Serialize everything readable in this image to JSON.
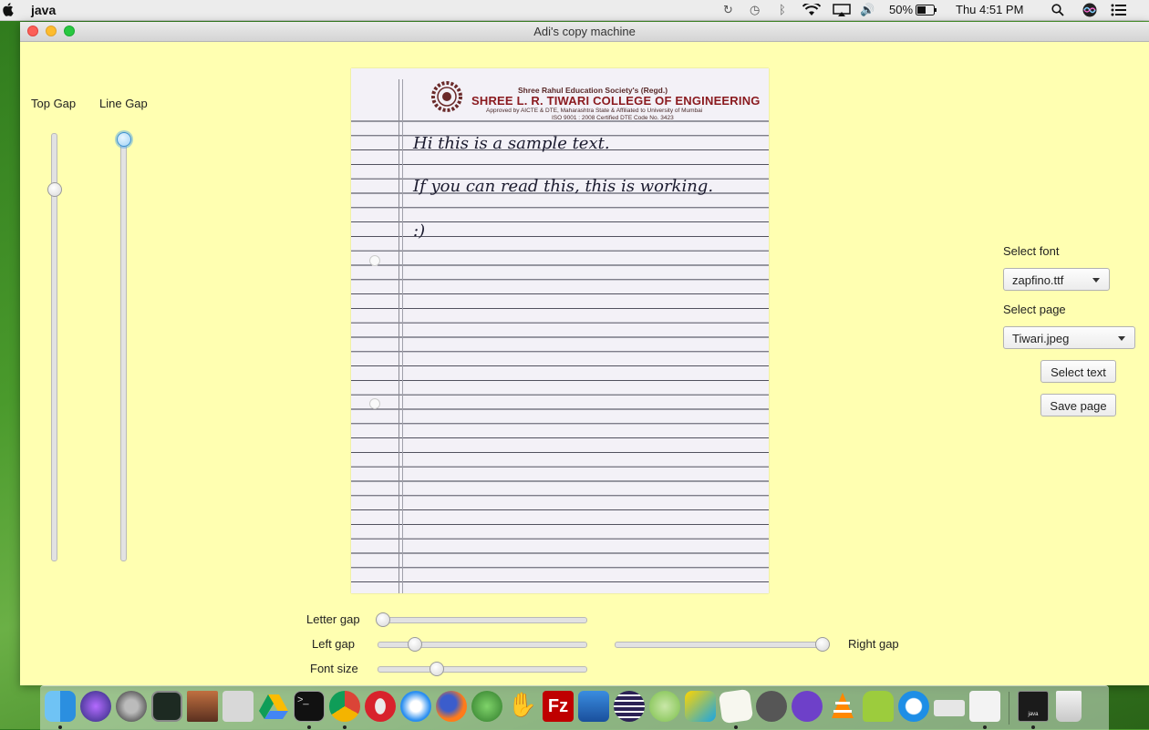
{
  "menubar": {
    "app_name": "java",
    "battery_percent": "50%",
    "clock": "Thu 4:51 PM"
  },
  "window": {
    "title": "Adi's copy machine"
  },
  "left_controls": {
    "top_gap_label": "Top Gap",
    "line_gap_label": "Line Gap",
    "top_gap_value": 0.12,
    "line_gap_value": 0.0
  },
  "paper": {
    "header_line1": "Shree Rahul Education Society's (Regd.)",
    "header_line2": "SHREE L. R. TIWARI COLLEGE OF ENGINEERING",
    "header_line3": "Approved by AICTE & DTE, Maharashtra State & Affiliated to University of Mumbai",
    "header_line4": "ISO 9001 : 2008 Certified   DTE Code No. 3423",
    "handwriting": [
      "Hi this is a sample text.",
      "If you can read this, this is working.",
      ":)"
    ]
  },
  "right_controls": {
    "select_font_label": "Select font",
    "font_value": "zapfino.ttf",
    "select_page_label": "Select page",
    "page_value": "Tiwari.jpeg",
    "select_text_button": "Select text",
    "save_page_button": "Save page"
  },
  "bottom_controls": {
    "letter_gap_label": "Letter gap",
    "left_gap_label": "Left gap",
    "right_gap_label": "Right gap",
    "font_size_label": "Font size",
    "letter_gap_value": 0.0,
    "left_gap_value": 0.16,
    "right_gap_value": 1.0,
    "font_size_value": 0.27
  },
  "dock": {
    "apps": [
      "Finder",
      "Siri",
      "System Preferences",
      "Activity Monitor",
      "Photo Booth",
      "Calculator",
      "Google Drive",
      "Terminal",
      "Chrome",
      "Opera",
      "Safari",
      "Firefox",
      "Globe",
      "Hand tool",
      "FileZilla",
      "Xcode",
      "Eclipse",
      "Android Studio",
      "WebStorm",
      "TextEdit",
      "Sequel",
      "GitHub Desktop",
      "VLC",
      "Android",
      "TeamViewer",
      "Printer",
      "Coffee",
      "Java",
      "Trash"
    ],
    "java_label": "java"
  }
}
